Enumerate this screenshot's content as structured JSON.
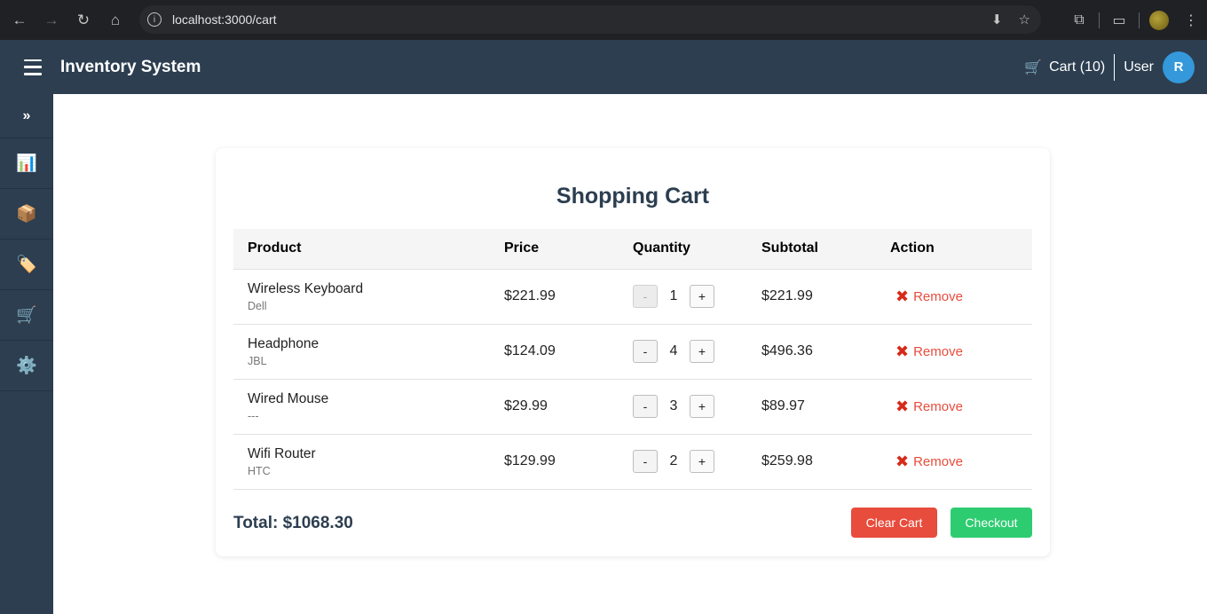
{
  "browser": {
    "url": "localhost:3000/cart"
  },
  "header": {
    "title": "Inventory System",
    "cart_label": "Cart (10)",
    "user_label": "User",
    "avatar_initial": "R"
  },
  "sidebar": {
    "toggle": "»",
    "items": [
      {
        "name": "dashboard",
        "icon": "📊"
      },
      {
        "name": "products",
        "icon": "📦"
      },
      {
        "name": "categories",
        "icon": "🏷️"
      },
      {
        "name": "cart",
        "icon": "🛒"
      },
      {
        "name": "settings",
        "icon": "⚙️"
      }
    ]
  },
  "cart": {
    "title": "Shopping Cart",
    "columns": [
      "Product",
      "Price",
      "Quantity",
      "Subtotal",
      "Action"
    ],
    "rows": [
      {
        "name": "Wireless Keyboard",
        "brand": "Dell",
        "price": "$221.99",
        "quantity": "1",
        "subtotal": "$221.99",
        "minus_disabled": true
      },
      {
        "name": "Headphone",
        "brand": "JBL",
        "price": "$124.09",
        "quantity": "4",
        "subtotal": "$496.36",
        "minus_disabled": false
      },
      {
        "name": "Wired Mouse",
        "brand": "---",
        "price": "$29.99",
        "quantity": "3",
        "subtotal": "$89.97",
        "minus_disabled": false
      },
      {
        "name": "Wifi Router",
        "brand": "HTC",
        "price": "$129.99",
        "quantity": "2",
        "subtotal": "$259.98",
        "minus_disabled": false
      }
    ],
    "minus_label": "-",
    "plus_label": "+",
    "remove_label": "Remove",
    "total": "Total: $1068.30",
    "clear_label": "Clear Cart",
    "checkout_label": "Checkout"
  },
  "colors": {
    "header_bg": "#2c3e50",
    "accent_blue": "#3498db",
    "danger": "#e74c3c",
    "success": "#2ecc71"
  }
}
